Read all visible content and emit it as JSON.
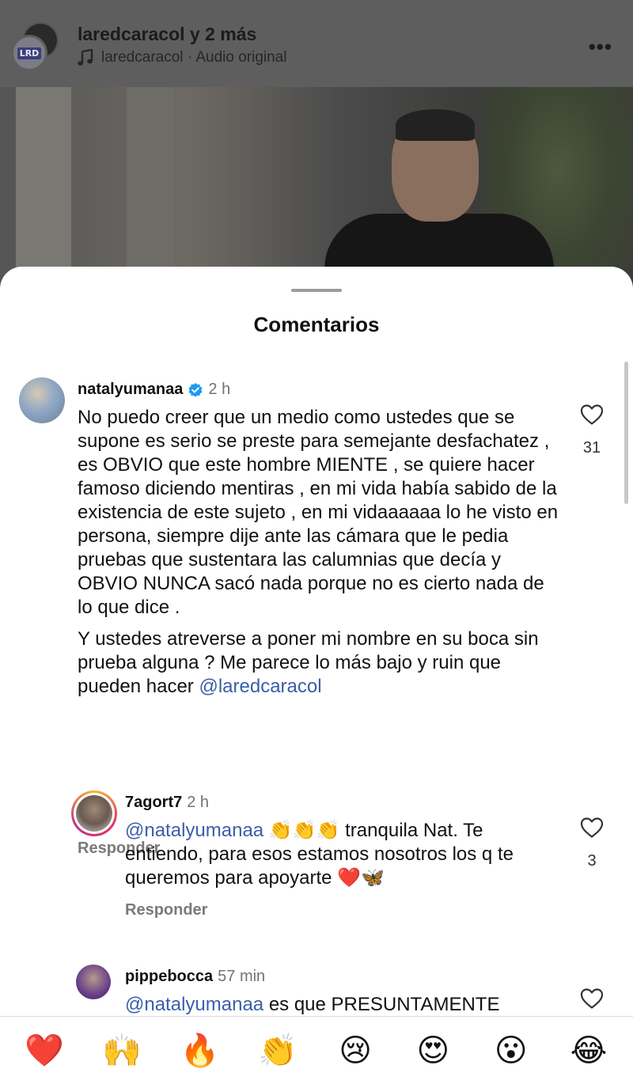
{
  "header": {
    "title": "laredcaracol y 2 más",
    "audio": "laredcaracol · Audio original",
    "badge": "LRD",
    "more": "•••"
  },
  "sheet": {
    "title": "Comentarios"
  },
  "comments": [
    {
      "username": "natalyumanaa",
      "verified": true,
      "time": "2 h",
      "paragraph1": "No puedo creer que un medio como ustedes  que se supone es serio se preste para semejante desfachatez , es OBVIO que este hombre MIENTE , se quiere hacer famoso diciendo mentiras , en mi vida había sabido de la existencia de este sujeto , en mi vidaaaaaa lo he visto en persona, siempre dije ante las cámara que le pedia pruebas que sustentara las calumnias  que decía y OBVIO NUNCA sacó nada porque no es cierto nada de lo que dice .",
      "paragraph2": "Y ustedes atreverse a poner mi nombre en su boca sin prueba alguna ? Me parece lo más bajo y ruin que pueden hacer",
      "mention": "@laredcaracol",
      "reply": "Responder",
      "likes": "31"
    },
    {
      "username": "7agort7",
      "time": "2 h",
      "mention": "@natalyumanaa",
      "emojis": "👏👏👏",
      "text": "tranquila Nat. Te entiendo, para esos estamos nosotros los q te queremos para apoyarte",
      "end_emojis": "❤️🦋",
      "reply": "Responder",
      "likes": "3"
    },
    {
      "username": "pippebocca",
      "time": "57 min",
      "mention": "@natalyumanaa",
      "text": "es que PRESUNTAMENTE"
    }
  ],
  "emoji_bar": [
    "❤️",
    "🙌",
    "🔥",
    "👏",
    "😢",
    "😍",
    "😮",
    "😂"
  ],
  "colors": {
    "mention": "#3b5ea8",
    "verified": "#1d9bf0",
    "reply": "#7a7a7a"
  }
}
